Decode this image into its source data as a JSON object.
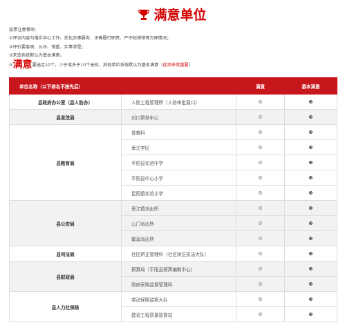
{
  "page_title": "满意单位",
  "notes": {
    "heading": "投票注意事项:",
    "lines": [
      "①评议内容为落实中心工作、优化办事服务、正确履行职责、严守纪律律等方面情况；",
      "②评价要客观、公正、慎重，实事求是；",
      "③未选系统默认为基本满意。"
    ],
    "line4_prefix": "④",
    "line4_big": "满意",
    "line4_text": "要选足10个，少于或多于10个无效，其他单位系统默认为基本满意（",
    "line4_red": "此项非常重要",
    "line4_end": "）"
  },
  "table": {
    "headers": {
      "unit": "单位名称（以下排名不按先后）",
      "satisfied": "满意",
      "basic": "基本满意"
    },
    "rows": [
      {
        "unit": "县政府办公室（县人防办）",
        "sub": "人防工程管理所（人防审批窗口）",
        "shade": false
      },
      {
        "unit": "县发改局",
        "sub": "对口帮扶中心",
        "shade": true
      },
      {
        "unit": "县教育局",
        "sub": "普教科",
        "shade": false
      },
      {
        "unit": "",
        "sub": "萧江学区",
        "shade": false
      },
      {
        "unit": "",
        "sub": "平阳县实验中学",
        "shade": false
      },
      {
        "unit": "",
        "sub": "平阳县中心小学",
        "shade": false
      },
      {
        "unit": "",
        "sub": "昆阳镇实验小学",
        "shade": false
      },
      {
        "unit": "县公安局",
        "sub": "萧江镇派出所",
        "shade": true
      },
      {
        "unit": "",
        "sub": "山门派出所",
        "shade": true
      },
      {
        "unit": "",
        "sub": "鳌溪派出所",
        "shade": true
      },
      {
        "unit": "县司法局",
        "sub": "社区矫正管理科（社区矫正执法大队）",
        "shade": false
      },
      {
        "unit": "县财政局",
        "sub": "预算局（平阳县预算编制中心）",
        "shade": true
      },
      {
        "unit": "",
        "sub": "政府采购监督管理科",
        "shade": true
      },
      {
        "unit": "县人力社保局",
        "sub": "劳动保障监察大队",
        "shade": false
      },
      {
        "unit": "",
        "sub": "建设工程质量监督站",
        "shade": false
      }
    ]
  }
}
